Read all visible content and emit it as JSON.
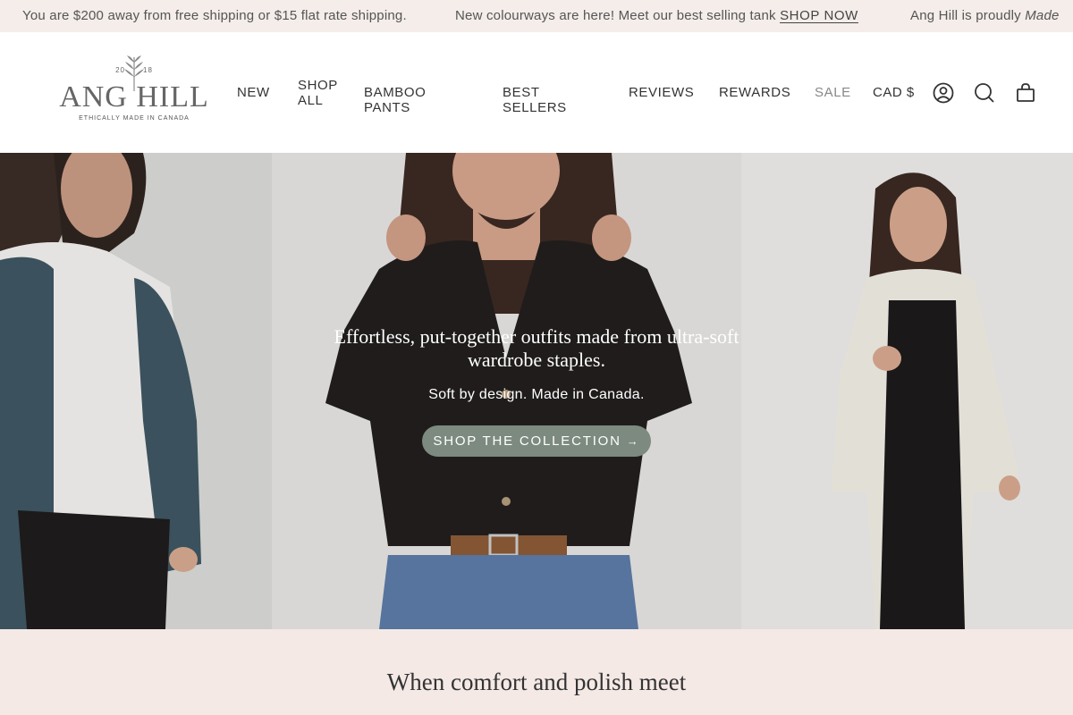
{
  "announcement": {
    "msg1": "You are $200 away from free shipping or $15 flat rate shipping.",
    "msg2_text": "New colourways are here! Meet our best selling tank ",
    "msg2_link": "SHOP NOW",
    "msg3_text": "Ang Hill is proudly ",
    "msg3_em": "Made"
  },
  "logo": {
    "year_left": "20",
    "year_right": "18",
    "name": "ANG HILL",
    "tagline": "ETHICALLY MADE IN CANADA"
  },
  "nav": {
    "items": [
      {
        "label": "NEW"
      },
      {
        "label": "SHOP\nALL"
      },
      {
        "label": "BAMBOO PANTS"
      },
      {
        "label": "BEST SELLERS"
      },
      {
        "label": "REVIEWS"
      },
      {
        "label": "REWARDS"
      },
      {
        "label": "SALE"
      }
    ],
    "currency": "CAD $"
  },
  "header_icons": [
    "account-icon",
    "search-icon",
    "cart-icon"
  ],
  "hero": {
    "title": "Effortless, put-together outfits made from ultra-soft wardrobe staples.",
    "subtitle": "Soft by design. Made in Canada.",
    "button_label": "SHOP THE COLLECTION",
    "button_icon": "arrow-right-icon"
  },
  "section": {
    "title": "When comfort and polish meet"
  },
  "colors": {
    "announcement_bg": "#f4ede9",
    "button_bg": "#7c8a7f",
    "section_bg": "#f4e9e5",
    "sale_text": "#888888"
  }
}
